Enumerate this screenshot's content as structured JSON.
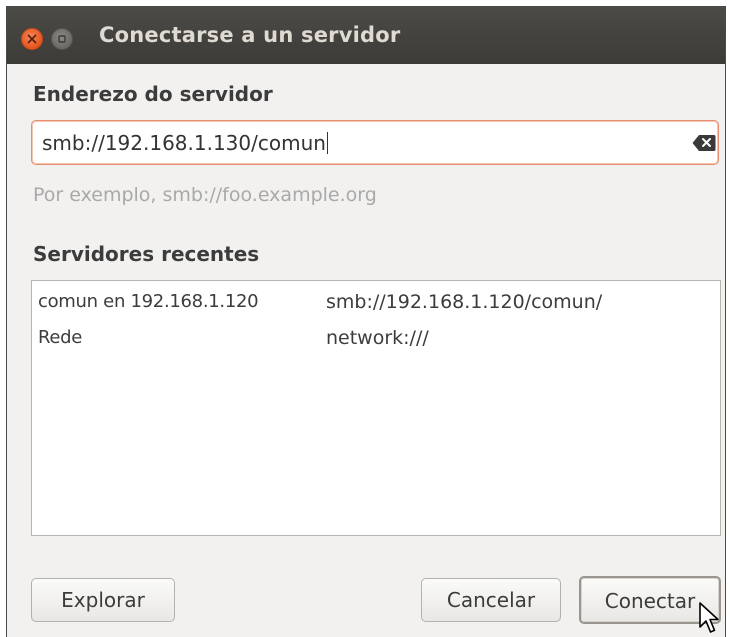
{
  "window": {
    "title": "Conectarse a un servidor"
  },
  "address": {
    "label": "Enderezo do servidor",
    "value": "smb://192.168.1.130/comun",
    "hint": "Por exemplo, smb://foo.example.org"
  },
  "recent": {
    "label": "Servidores recentes",
    "items": [
      {
        "name": "comun en 192.168.1.120",
        "uri": "smb://192.168.1.120/comun/"
      },
      {
        "name": "Rede",
        "uri": "network:///"
      }
    ]
  },
  "buttons": {
    "explore": "Explorar",
    "cancel": "Cancelar",
    "connect": "Conectar"
  },
  "icons": {
    "close": "close-icon",
    "minimize": "minimize-icon",
    "clear": "clear-text-icon",
    "cursor": "mouse-pointer-icon"
  },
  "colors": {
    "titlebar": "#3c3b37",
    "close_button": "#e5531a",
    "focus_border": "#e8906e"
  }
}
